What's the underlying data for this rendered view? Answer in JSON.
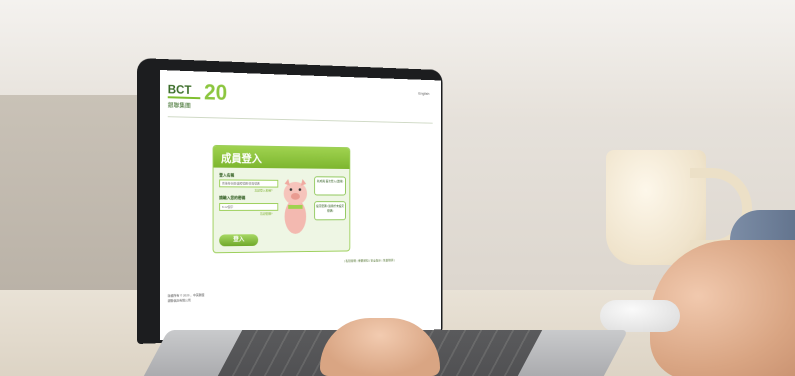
{
  "site": {
    "logo_text": "BCT",
    "logo_sub": "銀聯集團",
    "logo_badge": "20",
    "language_link": "English"
  },
  "login_card": {
    "title": "成員登入",
    "login_id_label": "登入名稱",
    "login_id_placeholder": "香港身份證/護照號碼/會員號碼",
    "forgot_login_id": "忘記登入名稱?",
    "password_label": "請輸入您的密碼",
    "password_placeholder": "8-12個字",
    "forgot_password": "忘記密碼?",
    "login_button": "登入",
    "new_member_button": "新成員 首次登入(選擇)",
    "setup_password_button": "設定密碼 (適用於未設定密碼)"
  },
  "footer_links": "| 私隱聲明 | 重要通知 | 安全提示 | 免責聲明 |",
  "footer_copyright": "版權所有 © 2020 ，中英聯盟",
  "footer_company": "銀聯信託有限公司"
}
